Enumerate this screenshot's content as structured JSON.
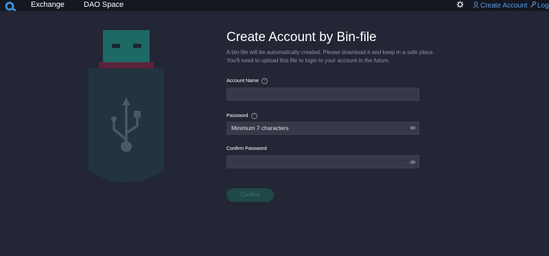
{
  "nav": {
    "links": [
      "Exchange",
      "DAO Space"
    ],
    "create_account": "Create Account",
    "login": "Logi"
  },
  "form": {
    "title": "Create Account by Bin-file",
    "description": [
      "A bin-file will be automatically created. Please download it and keep in a safe place.",
      "You'll need to upload this file to login to your account in the future."
    ],
    "account_name_label": "Account Name",
    "account_name_value": "",
    "password_label": "Password",
    "password_placeholder": "Minimum 7 characters",
    "confirm_password_label": "Confirm Password",
    "confirm_password_value": "",
    "help_glyph": "?",
    "confirm_button": "Confirm"
  },
  "icons": [
    "logo-icon",
    "gear-icon",
    "user-icon",
    "key-icon",
    "help-icon",
    "eye-icon",
    "usb-illustration"
  ],
  "colors": {
    "background": "#232634",
    "topbar": "#141720",
    "link_accent": "#5a9fe8",
    "input_bg": "#363a48",
    "usb_body": "#22343f",
    "usb_plug": "#1d6966",
    "usb_band": "#5a2339",
    "button_bg": "#1f4848",
    "button_text": "#3e7a74"
  }
}
